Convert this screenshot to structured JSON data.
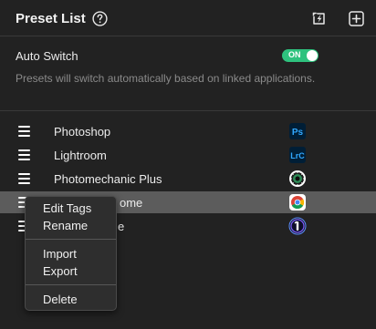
{
  "header": {
    "title": "Preset List",
    "help_icon": "help-circle-icon",
    "switch_icon": "lightning-switch-icon",
    "add_icon": "add-square-icon"
  },
  "auto_switch": {
    "label": "Auto Switch",
    "toggle_text": "ON",
    "enabled": true,
    "toggle_color": "#2ec27e",
    "description": "Presets will switch automatically based on linked applications."
  },
  "presets": [
    {
      "name": "Photoshop",
      "icon": "photoshop-icon"
    },
    {
      "name": "Lightroom",
      "icon": "lightroom-classic-icon"
    },
    {
      "name": "Photomechanic Plus",
      "icon": "photomechanic-icon"
    },
    {
      "name": "Chrome",
      "icon": "chrome-icon",
      "selected": true,
      "visible_text": "ome"
    },
    {
      "name": "1Password",
      "icon": "1password-icon",
      "visible_text": "e"
    }
  ],
  "context_menu": {
    "items": [
      "Edit Tags",
      "Rename",
      "Import",
      "Export",
      "Delete"
    ]
  },
  "colors": {
    "background": "#222222",
    "selected_row": "#5c5c5c",
    "accent_green": "#2ec27e"
  }
}
